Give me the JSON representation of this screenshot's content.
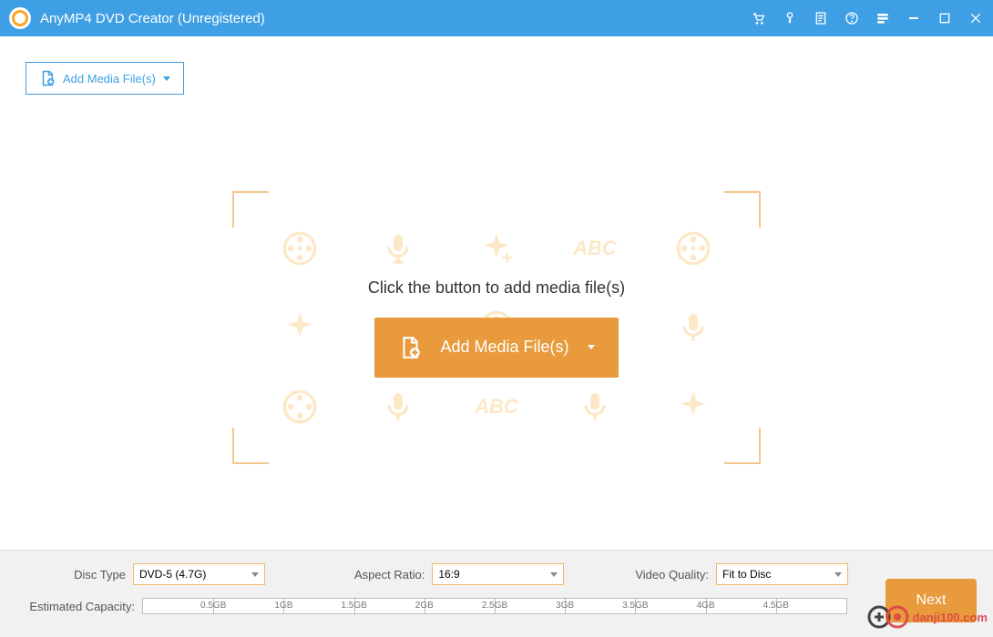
{
  "titlebar": {
    "app_name": "AnyMP4 DVD Creator (Unregistered)"
  },
  "toolbar": {
    "add_media_label": "Add Media File(s)"
  },
  "dropzone": {
    "hint": "Click the button to add media file(s)",
    "add_media_label": "Add Media File(s)",
    "bg_text": "ABC"
  },
  "bottom": {
    "disc_type_label": "Disc Type",
    "disc_type_value": "DVD-5 (4.7G)",
    "aspect_ratio_label": "Aspect Ratio:",
    "aspect_ratio_value": "16:9",
    "video_quality_label": "Video Quality:",
    "video_quality_value": "Fit to Disc",
    "estimated_capacity_label": "Estimated Capacity:",
    "capacity_ticks": [
      "0.5GB",
      "1GB",
      "1.5GB",
      "2GB",
      "2.5GB",
      "3GB",
      "3.5GB",
      "4GB",
      "4.5GB"
    ],
    "next_label": "Next"
  },
  "watermark": {
    "text": "danji100.com"
  }
}
